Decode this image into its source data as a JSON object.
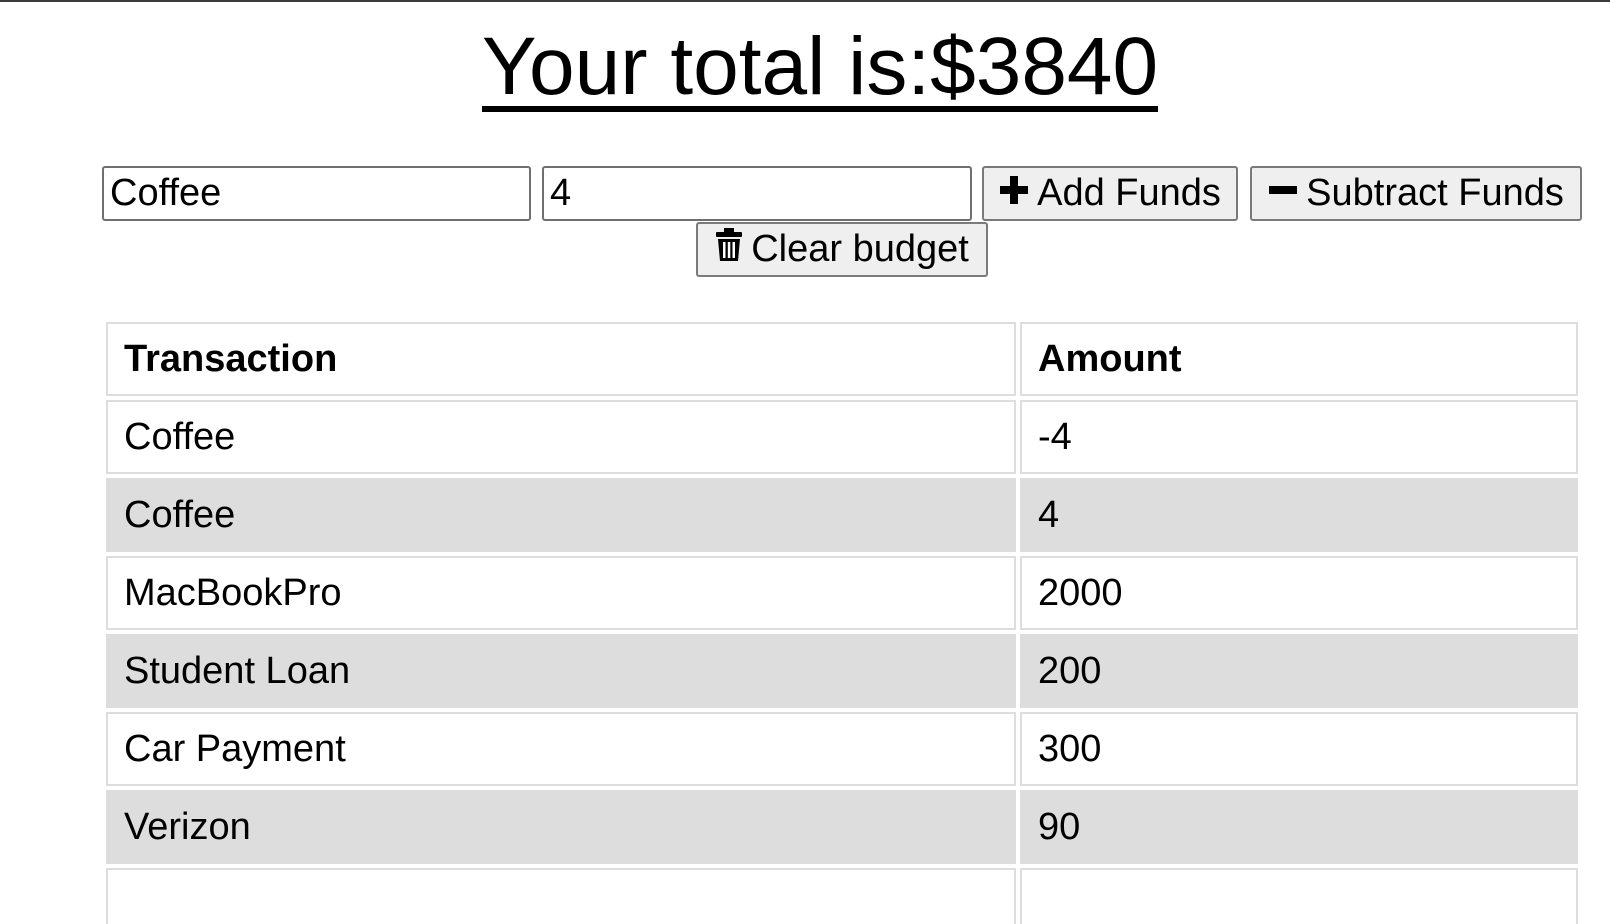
{
  "header": {
    "total_label": "Your total is: ",
    "total_value": "$3840"
  },
  "form": {
    "name_value": "Coffee",
    "amount_value": "4",
    "add_label": "Add Funds",
    "subtract_label": "Subtract Funds",
    "clear_label": "Clear budget",
    "add_icon": "plus-icon",
    "subtract_icon": "minus-icon",
    "clear_icon": "trash-icon"
  },
  "table": {
    "columns": [
      "Transaction",
      "Amount"
    ],
    "rows": [
      {
        "transaction": "Coffee",
        "amount": "-4"
      },
      {
        "transaction": "Coffee",
        "amount": "4"
      },
      {
        "transaction": "MacBookPro",
        "amount": "2000"
      },
      {
        "transaction": "Student Loan",
        "amount": "200"
      },
      {
        "transaction": "Car Payment",
        "amount": "300"
      },
      {
        "transaction": "Verizon",
        "amount": "90"
      },
      {
        "transaction": "",
        "amount": ""
      }
    ]
  },
  "colors": {
    "stripe": "#dddddd",
    "button_bg": "#efefef"
  }
}
